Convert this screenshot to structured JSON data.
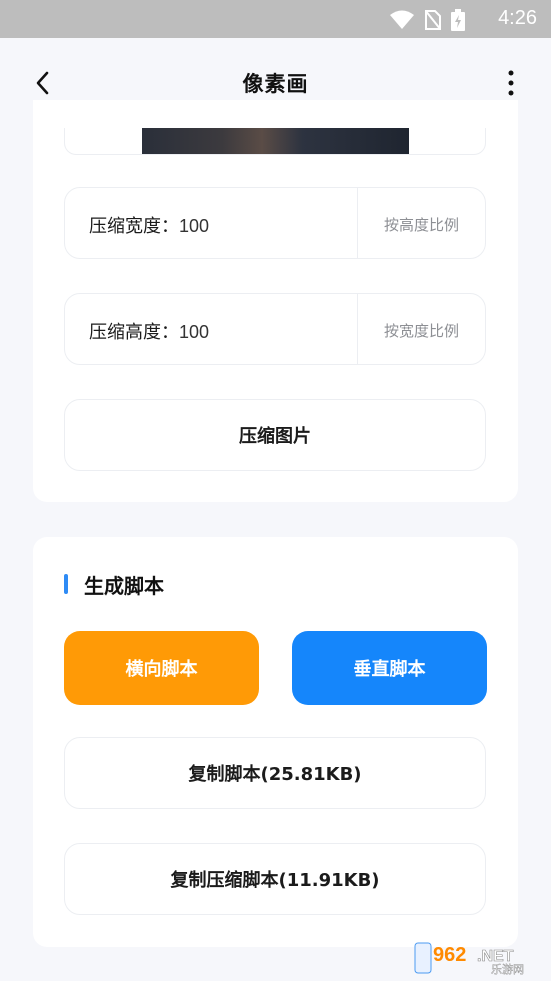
{
  "status_bar": {
    "time": "4:26"
  },
  "header": {
    "title": "像素画"
  },
  "compress": {
    "width_label": "压缩宽度：",
    "width_value": "100",
    "width_side": "按高度比例",
    "height_label": "压缩高度：",
    "height_value": "100",
    "height_side": "按宽度比例",
    "compress_button": "压缩图片"
  },
  "script_section": {
    "title": "生成脚本",
    "horizontal_button": "横向脚本",
    "vertical_button": "垂直脚本",
    "copy_script_button": "复制脚本(25.81KB)",
    "copy_compressed_button": "复制压缩脚本(11.91KB)"
  },
  "watermark": {
    "number": "962",
    "suffix": ".NET",
    "subtitle": "乐游网"
  },
  "colors": {
    "accent": "#1586fb",
    "orange": "#ff9a06",
    "section_bar": "#2e8bf5"
  }
}
